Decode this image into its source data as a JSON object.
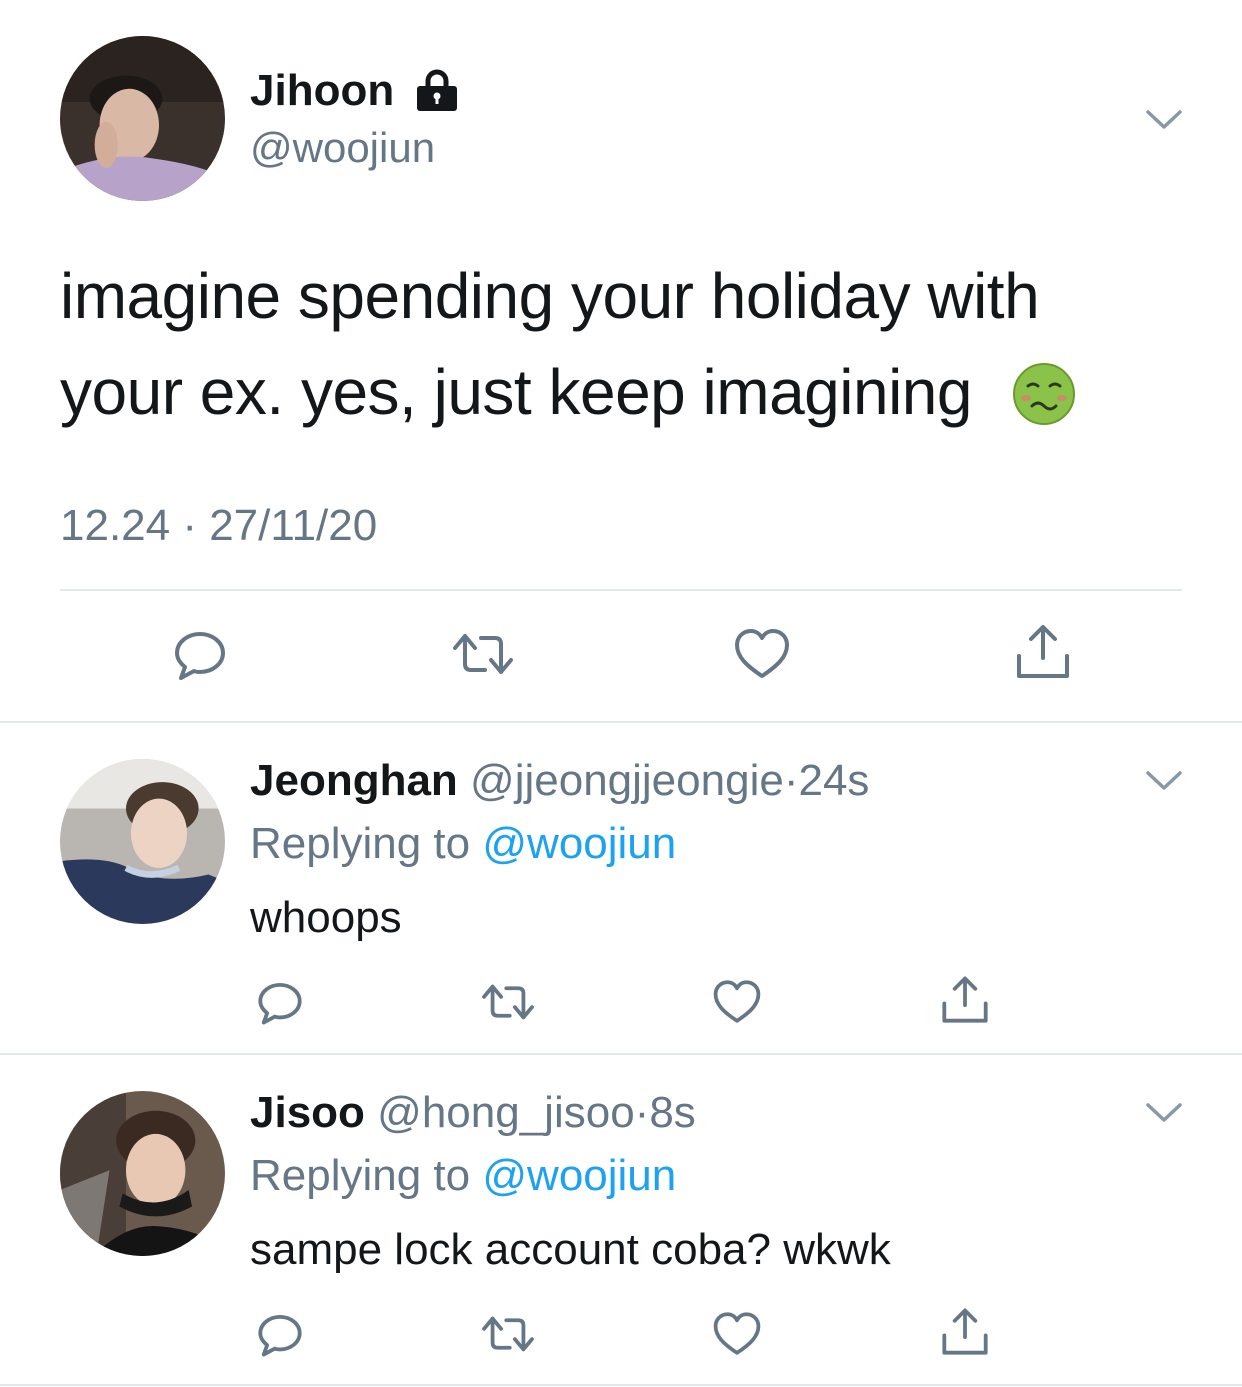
{
  "main_tweet": {
    "display_name": "Jihoon",
    "handle": "@woojiun",
    "text_line1": "imagine spending your holiday with",
    "text_line2": "your ex. yes, just keep imagining",
    "emoji": "🤢",
    "timestamp": "12.24 · 27/11/20",
    "protected_icon": "lock-icon",
    "actions": [
      "reply-icon",
      "retweet-icon",
      "like-icon",
      "share-icon"
    ]
  },
  "replies": [
    {
      "display_name": "Jeonghan",
      "handle": "@jjeongjjeongie",
      "separator": "·",
      "time": "24s",
      "replying_label": "Replying to",
      "replying_handle": "@woojiun",
      "text": "whoops"
    },
    {
      "display_name": "Jisoo",
      "handle": "@hong_jisoo",
      "separator": "·",
      "time": "8s",
      "replying_label": "Replying to",
      "replying_handle": "@woojiun",
      "text": "sampe lock account coba? wkwk"
    }
  ],
  "colors": {
    "text": "#14171a",
    "muted": "#657786",
    "link": "#1da1f2",
    "divider": "#e1e8ed"
  }
}
